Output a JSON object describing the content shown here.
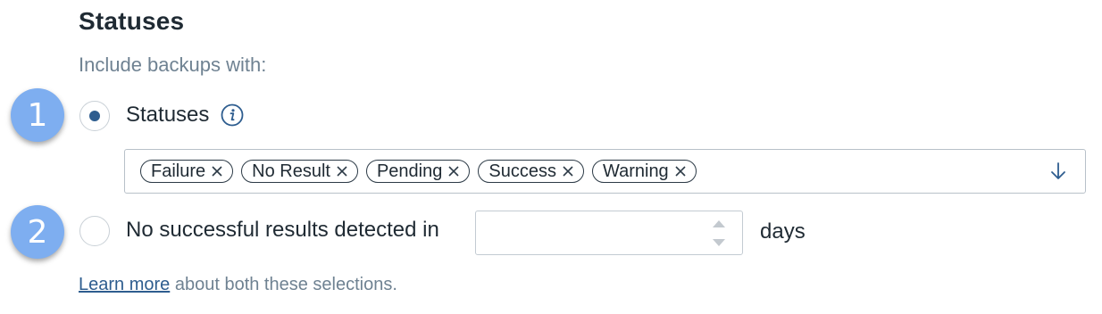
{
  "section": {
    "title": "Statuses",
    "subtitle": "Include backups with:"
  },
  "steps": [
    "1",
    "2"
  ],
  "option_statuses": {
    "label": "Statuses",
    "selected": true,
    "info_icon": "info-icon"
  },
  "status_select": {
    "chips": [
      "Failure",
      "No Result",
      "Pending",
      "Success",
      "Warning"
    ],
    "remove_icon": "close-icon",
    "dropdown_icon": "arrow-down-icon"
  },
  "option_no_success": {
    "label": "No successful results detected in",
    "selected": false,
    "input_value": "",
    "unit": "days"
  },
  "help": {
    "link_text": "Learn more",
    "rest_text": " about both these selections."
  },
  "colors": {
    "accent": "#2e5d8f",
    "badge": "#7eaef0",
    "muted_text": "#6f8292"
  }
}
